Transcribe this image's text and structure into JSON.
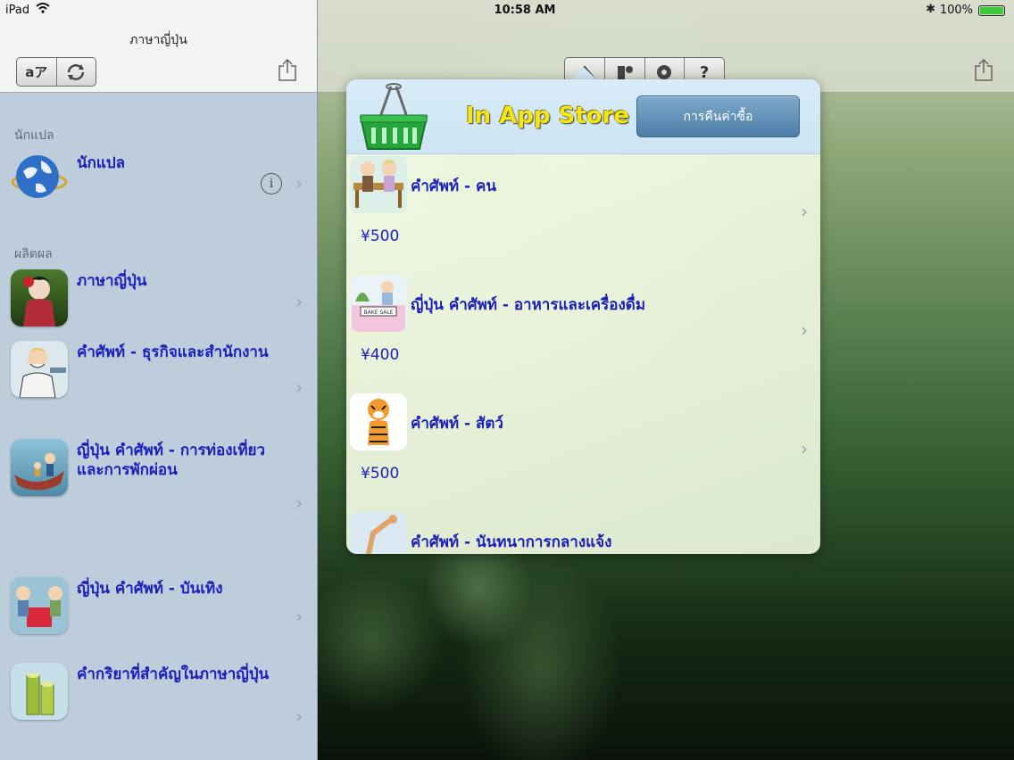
{
  "status": {
    "device": "iPad",
    "time": "10:58 AM",
    "battery": "100%"
  },
  "master": {
    "title": "ภาษาญี่ปุ่น",
    "toolbar": {
      "translate_icon": "aア",
      "sync_icon": "sync-icon",
      "share_icon": "share-icon"
    },
    "sections": [
      {
        "label": "นักแปล",
        "items": [
          {
            "label": "นักแปล",
            "thumb": "globe-icon",
            "has_info": true
          }
        ]
      },
      {
        "label": "ผลิตผล",
        "items": [
          {
            "label": "ภาษาญี่ปุ่น",
            "thumb": "geisha-icon"
          },
          {
            "label": "คำศัพท์ - ธุรกิจและสำนักงาน",
            "thumb": "businessman-icon"
          },
          {
            "label": "ญี่ปุ่น คำศัพท์ - การท่องเที่ยวและการพักผ่อน",
            "thumb": "boat-icon"
          },
          {
            "label": "ญี่ปุ่น คำศัพท์ - บันเทิง",
            "thumb": "dining-icon"
          },
          {
            "label": "คำกริยาที่สำคัญในภาษาญี่ปุ่น",
            "thumb": "bamboo-icon"
          }
        ]
      }
    ]
  },
  "detail": {
    "segments": [
      "store-icon",
      "tools-icon",
      "gear-icon",
      "?"
    ],
    "share_icon": "share-icon"
  },
  "popover": {
    "title": "In App Store",
    "restore_label": "การคืนค่าซื้อ",
    "items": [
      {
        "label": "คำศัพท์ - คน",
        "price": "¥500",
        "thumb": "couple-icon"
      },
      {
        "label": "ญี่ปุ่น คำศัพท์ - อาหารและเครื่องดื่ม",
        "price": "¥400",
        "thumb": "bake-sale-icon",
        "thumb_text": "BAKE SALE"
      },
      {
        "label": "คำศัพท์ - สัตว์",
        "price": "¥500",
        "thumb": "tiger-icon"
      },
      {
        "label": "คำศัพท์ - นันทนาการกลางแจ้ง",
        "price": "",
        "thumb": "gymnast-icon"
      }
    ]
  },
  "colors": {
    "link_blue": "#1b1fb8",
    "store_title": "#f4e514",
    "restore_button": "#5e8db4"
  }
}
